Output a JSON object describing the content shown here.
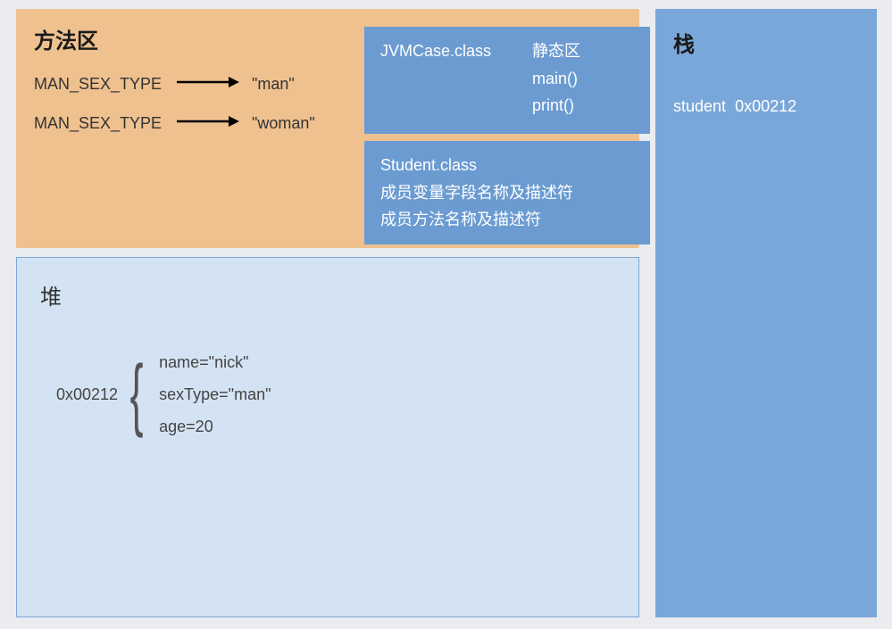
{
  "methodArea": {
    "title": "方法区",
    "constants": [
      {
        "name": "MAN_SEX_TYPE",
        "value": "\"man\""
      },
      {
        "name": "MAN_SEX_TYPE",
        "value": "\"woman\""
      }
    ],
    "jvmCaseClass": {
      "className": "JVMCase.class",
      "staticLabel": "静态区",
      "methods": [
        "main()",
        "print()"
      ]
    },
    "studentClass": {
      "className": "Student.class",
      "fieldDesc": "成员变量字段名称及描述符",
      "methodDesc": "成员方法名称及描述符"
    }
  },
  "stack": {
    "title": "栈",
    "entries": [
      {
        "ref": "student",
        "addr": "0x00212"
      }
    ]
  },
  "heap": {
    "title": "堆",
    "objects": [
      {
        "addr": "0x00212",
        "fields": [
          "name=\"nick\"",
          "sexType=\"man\"",
          "age=20"
        ]
      }
    ]
  }
}
